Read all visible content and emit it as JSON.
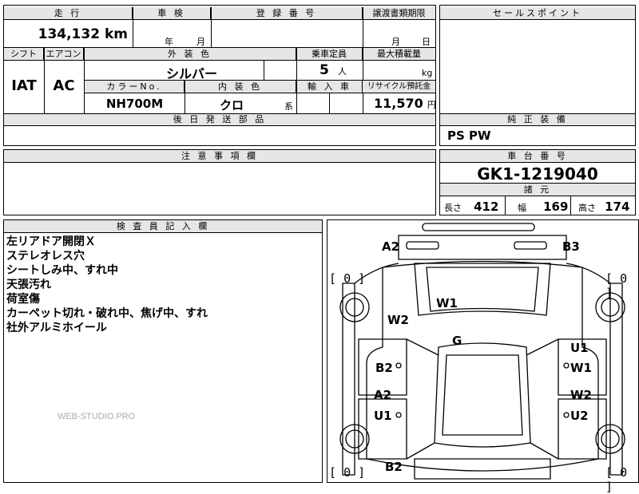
{
  "main": {
    "headers": {
      "mileage": "走 行",
      "inspection": "車 検",
      "registration": "登 録 番 号",
      "transfer_deadline": "譲渡書類期限",
      "shift": "シフト",
      "aircon": "エアコン",
      "exterior_color": "外 装 色",
      "capacity": "乗車定員",
      "max_load": "最大積載量",
      "color_no": "カラーNo.",
      "interior_color": "内 装 色",
      "import": "輸 入 車",
      "recycle_fee": "リサイクル預託金",
      "later_parts": "後 日 発 送 部 品",
      "notes": "注 意 事 項 欄",
      "inspector_notes": "検 査 員 記 入 欄"
    },
    "mileage_value": "134,132",
    "mileage_unit": "km",
    "inspection_year": "年",
    "inspection_month": "月",
    "transfer_month": "月",
    "transfer_day": "日",
    "shift_value": "IAT",
    "aircon_value": "AC",
    "exterior_color_value": "シルバー",
    "capacity_value": "5",
    "capacity_unit": "人",
    "max_load_unit": "kg",
    "color_no_value": "NH700M",
    "interior_color_value": "クロ",
    "interior_color_suffix": "系",
    "recycle_value": "11,570",
    "recycle_unit": "円",
    "inspector_lines": [
      "左リアドア開閉Ｘ",
      "ステレオレス穴",
      "シートしみ中、すれ中",
      "天張汚れ",
      "荷室傷",
      "カーペット切れ・破れ中、焦げ中、すれ",
      "社外アルミホイール"
    ],
    "watermark": "WEB-STUDIO.PRO"
  },
  "side": {
    "sales_point_header": "セールスポイント",
    "equipment_header": "純 正 装 備",
    "equipment_value": "PS PW",
    "chassis_header": "車 台 番 号",
    "chassis_value": "GK1-1219040",
    "dims_header": "諸 元",
    "length_label": "長さ",
    "length_value": "412",
    "width_label": "幅",
    "width_value": "169",
    "height_label": "高さ",
    "height_value": "174"
  },
  "diagram": {
    "labels": {
      "a2_top": "A2",
      "b3_top": "B3",
      "w1_center": "W1",
      "w2_left": "W2",
      "g_center": "G",
      "b2_left": "B2",
      "u1_right": "U1",
      "w1_right": "W1",
      "a2_left": "A2",
      "u1_left": "U1",
      "w2_right": "W2",
      "u2_right": "U2",
      "b2_bottom": "B2"
    },
    "tires": {
      "front_left": "0",
      "front_right": "0",
      "rear_left": "0",
      "rear_right": "0"
    }
  }
}
